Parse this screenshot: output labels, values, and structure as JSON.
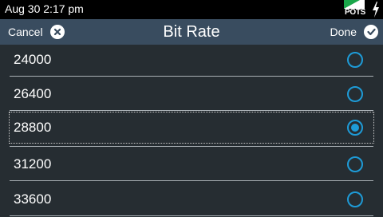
{
  "status_bar": {
    "time": "Aug 30 2:17 pm",
    "line_label": "POTS",
    "line_icon": "pots-line-icon",
    "power_icon": "lightning-bolt-icon"
  },
  "header": {
    "cancel_label": "Cancel",
    "cancel_icon": "close-circle-icon",
    "title": "Bit Rate",
    "done_label": "Done",
    "done_icon": "check-circle-icon"
  },
  "options": [
    {
      "label": "24000",
      "selected": false
    },
    {
      "label": "26400",
      "selected": false
    },
    {
      "label": "28800",
      "selected": true
    },
    {
      "label": "31200",
      "selected": false
    },
    {
      "label": "33600",
      "selected": false
    }
  ],
  "colors": {
    "accent": "#1e9bd7",
    "header_bg": "#394c5f",
    "list_bg": "#262d32",
    "pots_green": "#1aa64a"
  }
}
